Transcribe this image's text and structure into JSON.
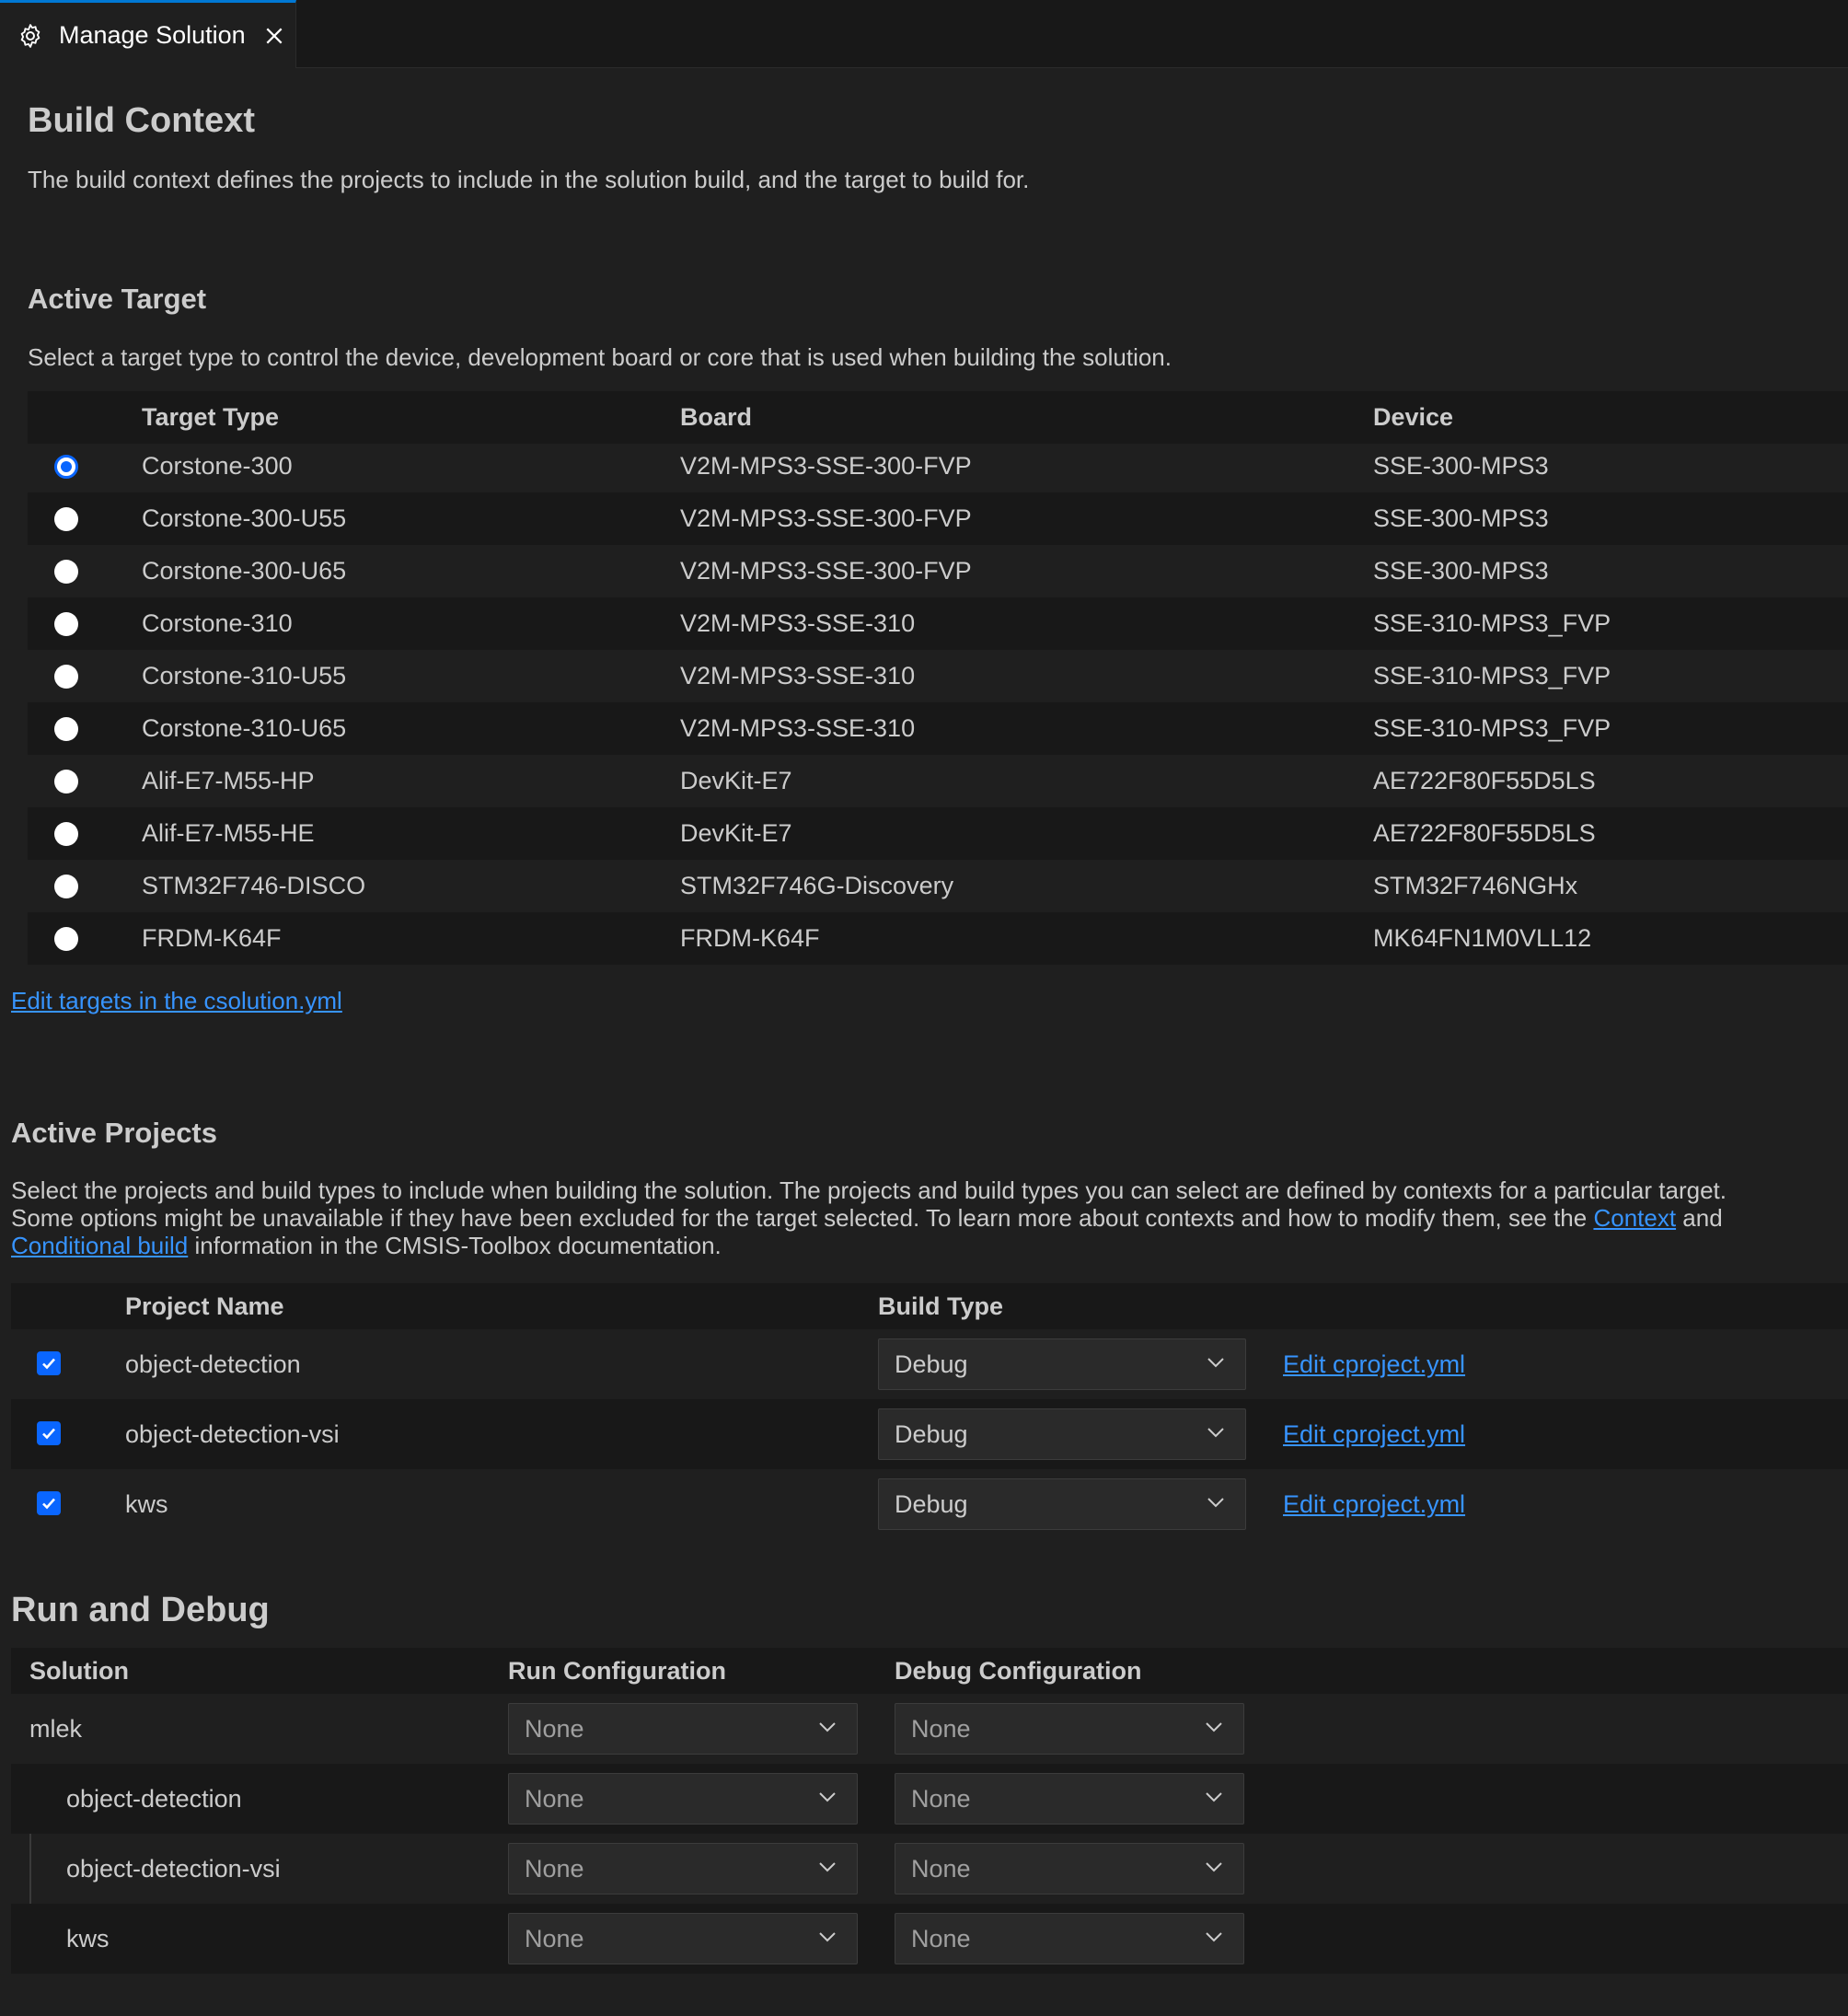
{
  "tab": {
    "label": "Manage Solution",
    "icon": "gear-icon",
    "close_icon": "close-icon"
  },
  "build_context": {
    "title": "Build Context",
    "description": "The build context defines the projects to include in the solution build, and the target to build for."
  },
  "active_target": {
    "title": "Active Target",
    "description": "Select a target type to control the device, development board or core that is used when building the solution.",
    "columns": [
      "Target Type",
      "Board",
      "Device"
    ],
    "rows": [
      {
        "type": "Corstone-300",
        "board": "V2M-MPS3-SSE-300-FVP",
        "device": "SSE-300-MPS3",
        "selected": true
      },
      {
        "type": "Corstone-300-U55",
        "board": "V2M-MPS3-SSE-300-FVP",
        "device": "SSE-300-MPS3",
        "selected": false
      },
      {
        "type": "Corstone-300-U65",
        "board": "V2M-MPS3-SSE-300-FVP",
        "device": "SSE-300-MPS3",
        "selected": false
      },
      {
        "type": "Corstone-310",
        "board": "V2M-MPS3-SSE-310",
        "device": "SSE-310-MPS3_FVP",
        "selected": false
      },
      {
        "type": "Corstone-310-U55",
        "board": "V2M-MPS3-SSE-310",
        "device": "SSE-310-MPS3_FVP",
        "selected": false
      },
      {
        "type": "Corstone-310-U65",
        "board": "V2M-MPS3-SSE-310",
        "device": "SSE-310-MPS3_FVP",
        "selected": false
      },
      {
        "type": "Alif-E7-M55-HP",
        "board": "DevKit-E7",
        "device": "AE722F80F55D5LS",
        "selected": false
      },
      {
        "type": "Alif-E7-M55-HE",
        "board": "DevKit-E7",
        "device": "AE722F80F55D5LS",
        "selected": false
      },
      {
        "type": "STM32F746-DISCO",
        "board": "STM32F746G-Discovery",
        "device": "STM32F746NGHx",
        "selected": false
      },
      {
        "type": "FRDM-K64F",
        "board": "FRDM-K64F",
        "device": "MK64FN1M0VLL12",
        "selected": false
      }
    ],
    "edit_link": "Edit targets in the csolution.yml"
  },
  "active_projects": {
    "title": "Active Projects",
    "description_line1": "Select the projects and build types to include when building the solution. The projects and build types you can select are defined by contexts for a particular target.",
    "description_line2_pre": "Some options might be unavailable if they have been excluded for the target selected. To learn more about contexts and how to modify them, see the ",
    "context_link": "Context",
    "description_line2_post": " and",
    "conditional_link": "Conditional build",
    "description_line3_post": " information in the CMSIS-Toolbox documentation.",
    "columns": [
      "Project Name",
      "Build Type"
    ],
    "rows": [
      {
        "name": "object-detection",
        "build_type": "Debug",
        "checked": true,
        "edit": "Edit cproject.yml"
      },
      {
        "name": "object-detection-vsi",
        "build_type": "Debug",
        "checked": true,
        "edit": "Edit cproject.yml"
      },
      {
        "name": "kws",
        "build_type": "Debug",
        "checked": true,
        "edit": "Edit cproject.yml"
      }
    ]
  },
  "run_debug": {
    "title": "Run and Debug",
    "columns": [
      "Solution",
      "Run Configuration",
      "Debug Configuration"
    ],
    "rows": [
      {
        "name": "mlek",
        "run": "None",
        "debug": "None"
      },
      {
        "name": "object-detection",
        "run": "None",
        "debug": "None"
      },
      {
        "name": "object-detection-vsi",
        "run": "None",
        "debug": "None"
      },
      {
        "name": "kws",
        "run": "None",
        "debug": "None"
      }
    ]
  },
  "colors": {
    "background": "#1f1f1f",
    "accent": "#0a66ff",
    "link": "#3794ff",
    "alt_row": "#181818"
  }
}
